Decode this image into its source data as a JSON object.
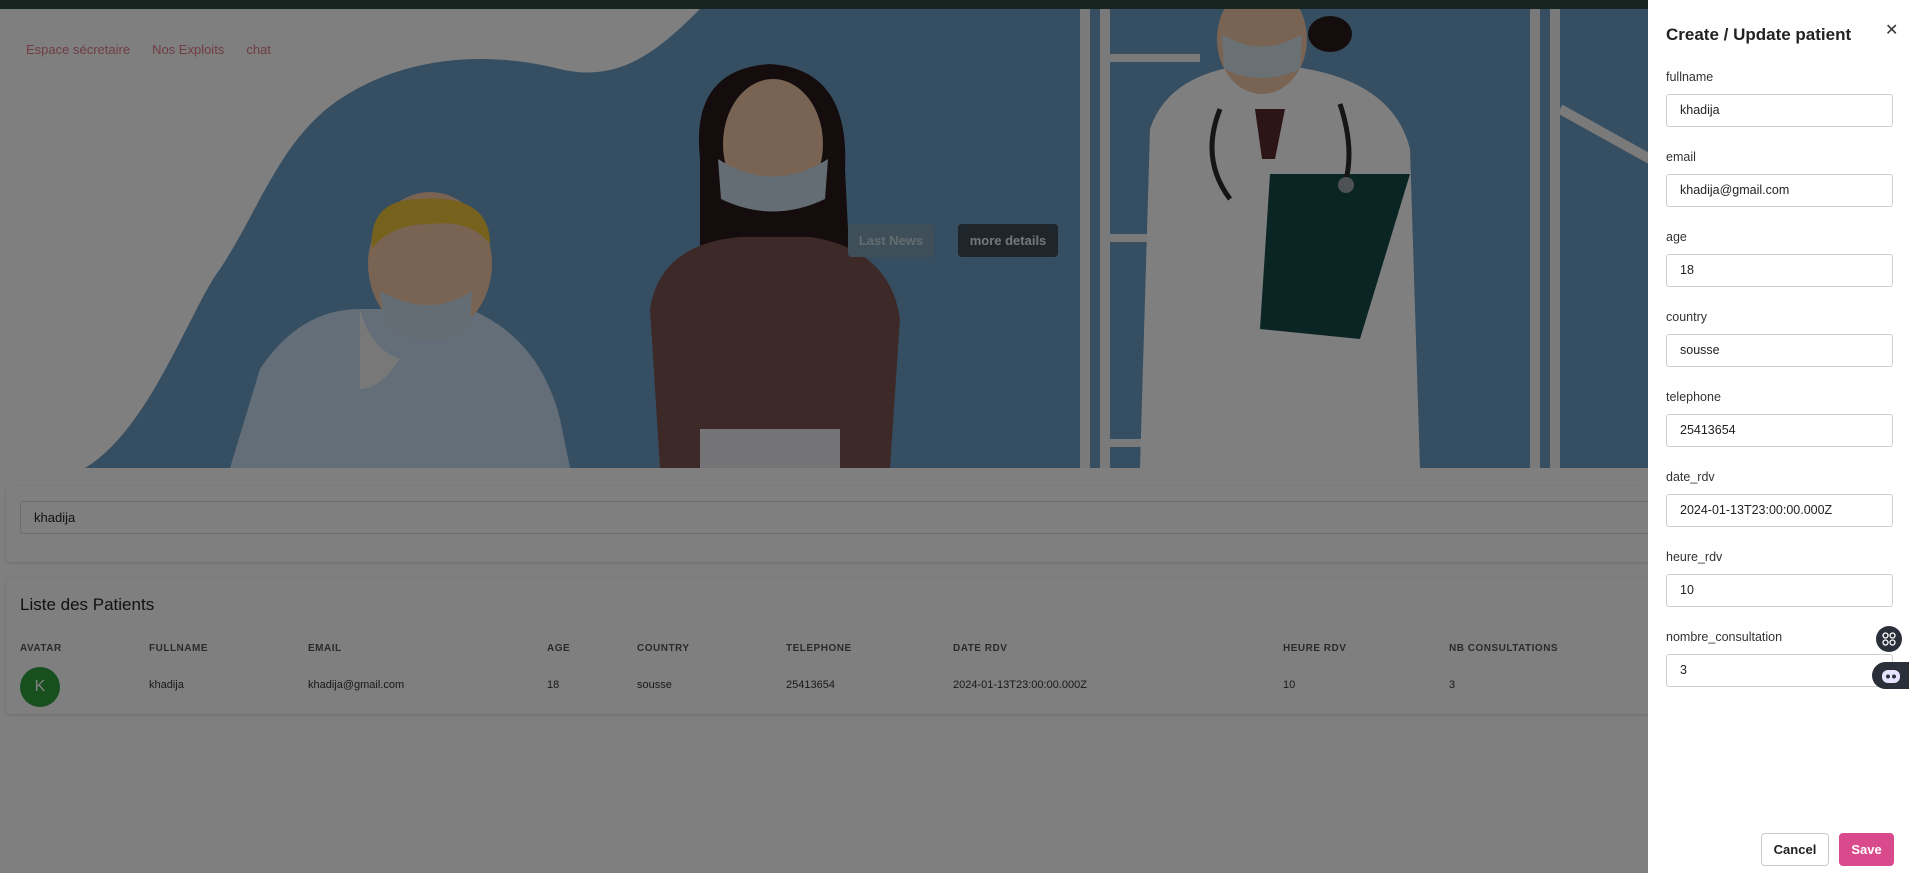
{
  "nav": {
    "items": [
      "Espace sécretaire",
      "Nos Exploits",
      "chat"
    ]
  },
  "hero": {
    "news_button": "Last News",
    "details_button": "more details"
  },
  "search": {
    "value": "khadija"
  },
  "patients": {
    "title": "Liste des Patients",
    "columns": [
      "AVATAR",
      "FULLNAME",
      "EMAIL",
      "AGE",
      "COUNTRY",
      "TELEPHONE",
      "DATE RDV",
      "HEURE RDV",
      "NB CONSULTATIONS"
    ],
    "rows": [
      {
        "avatar": "K",
        "fullname": "khadija",
        "email": "khadija@gmail.com",
        "age": "18",
        "country": "sousse",
        "telephone": "25413654",
        "date_rdv": "2024-01-13T23:00:00.000Z",
        "heure_rdv": "10",
        "nb_consultations": "3"
      }
    ]
  },
  "drawer": {
    "title": "Create / Update patient",
    "fields": [
      {
        "label": "fullname",
        "value": "khadija"
      },
      {
        "label": "email",
        "value": "khadija@gmail.com"
      },
      {
        "label": "age",
        "value": "18"
      },
      {
        "label": "country",
        "value": "sousse"
      },
      {
        "label": "telephone",
        "value": "25413654"
      },
      {
        "label": "date_rdv",
        "value": "2024-01-13T23:00:00.000Z"
      },
      {
        "label": "heure_rdv",
        "value": "10"
      },
      {
        "label": "nombre_consultation",
        "value": "3"
      }
    ],
    "cancel_label": "Cancel",
    "save_label": "Save"
  },
  "colors": {
    "nav_link": "#e07a8f",
    "save_button": "#d94a8c",
    "avatar": "#2e9e3a",
    "hero_bg": "#6a9cc4"
  },
  "icons": {
    "close": "close-icon",
    "float_apps": "grid-icon",
    "float_bot": "robot-icon"
  }
}
